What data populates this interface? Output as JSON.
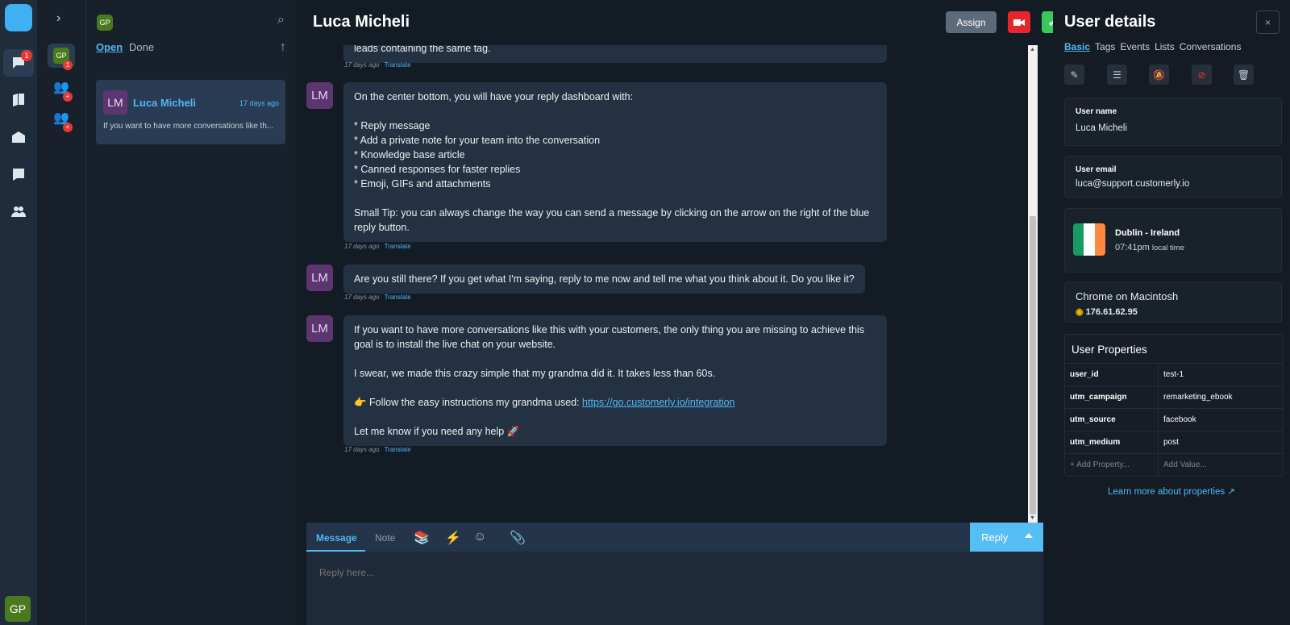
{
  "rail": {
    "badge_count": "1",
    "me_initials": "GP"
  },
  "agents": {
    "current_initials": "GP",
    "current_badge": "1"
  },
  "list": {
    "header_initials": "GP",
    "tab_open": "Open",
    "tab_done": "Done",
    "conversations": [
      {
        "initials": "LM",
        "name": "Luca Micheli",
        "time": "17 days ago",
        "preview": "If you want to have more conversations like th..."
      }
    ]
  },
  "chat": {
    "title": "Luca Micheli",
    "assign_label": "Assign",
    "top_partial": "leads containing the same tag.",
    "messages": [
      {
        "initials": "LM",
        "text": "On the center bottom, you will have your reply dashboard with:\n\n* Reply message\n* Add a private note for your team into the conversation\n* Knowledge base article\n* Canned responses for faster replies\n* Emoji, GIFs and attachments\n\nSmall Tip: you can always change the way you can send a message by clicking on the arrow on the right of the blue reply button.",
        "time": "17 days ago",
        "translate": "Translate"
      },
      {
        "initials": "LM",
        "text": "Are you still there? If you get what I'm saying, reply to me now and tell me what you think about it. Do you like it?",
        "time": "17 days ago",
        "translate": "Translate"
      },
      {
        "initials": "LM",
        "text_a": "If you want to have more conversations like this with your customers, the only thing you are missing to achieve this goal is to install the live chat on your website.\n\nI swear, we made this crazy simple that my grandma did it. It takes less than 60s.\n\n👉 Follow the easy instructions my grandma used: ",
        "link": "https://go.customerly.io/integration",
        "text_b": "\n\nLet me know if you need any help 🚀",
        "time": "17 days ago",
        "translate": "Translate"
      }
    ],
    "meta_first": {
      "time": "17 days ago",
      "translate": "Translate"
    }
  },
  "composer": {
    "tab_message": "Message",
    "tab_note": "Note",
    "reply_label": "Reply",
    "placeholder": "Reply here..."
  },
  "details": {
    "title": "User details",
    "close": "×",
    "tabs": [
      "Basic",
      "Tags",
      "Events",
      "Lists",
      "Conversations"
    ],
    "user_name_label": "User name",
    "user_name": "Luca Micheli",
    "user_email_label": "User email",
    "user_email": "luca@support.customerly.io",
    "location": "Dublin - Ireland",
    "local_time": "07:41pm",
    "local_time_suffix": "local time",
    "browser": "Chrome on Macintosh",
    "ip": "176.61.62.95",
    "props_title": "User Properties",
    "properties": [
      {
        "key": "user_id",
        "value": "test-1"
      },
      {
        "key": "utm_campaign",
        "value": "remarketing_ebook"
      },
      {
        "key": "utm_source",
        "value": "facebook"
      },
      {
        "key": "utm_medium",
        "value": "post"
      }
    ],
    "add_property": "Add Property...",
    "add_value": "Add Value...",
    "learn_more": "Learn more about properties"
  },
  "colors": {
    "accent": "#4fb8f5",
    "reply_button": "#56bdf5",
    "video_button": "#e5262a",
    "done_button": "#38c95a",
    "avatar_lm": "#5d3570"
  }
}
